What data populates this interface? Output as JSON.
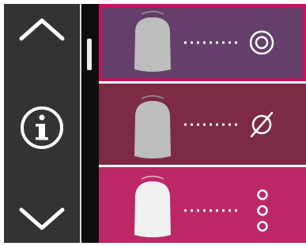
{
  "navigation": {
    "up_icon": "chevron-up-icon",
    "info_icon": "info-icon",
    "down_icon": "chevron-down-icon"
  },
  "modes": [
    {
      "tooth_shade": "light-gray",
      "indicator_icon": "double-ring-icon",
      "selected": true
    },
    {
      "tooth_shade": "light-gray",
      "indicator_icon": "empty-set-icon",
      "selected": false
    },
    {
      "tooth_shade": "white",
      "indicator_icon": "three-rings-icon",
      "selected": false
    }
  ],
  "colors": {
    "nav_background": "#333333",
    "mode_1_background": "#633f6a",
    "mode_1_selected_border": "#c4135f",
    "mode_2_background": "#7d2a46",
    "mode_3_background": "#bc2866",
    "scroll_track": "#0d0d0d",
    "icon_stroke": "#ffffff"
  }
}
